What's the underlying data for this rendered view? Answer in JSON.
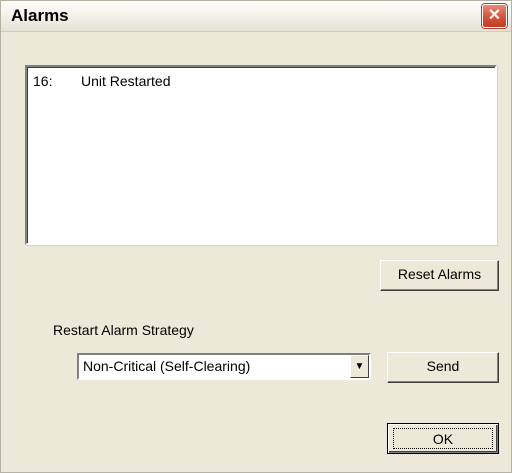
{
  "window": {
    "title": "Alarms",
    "close_icon": "close-icon"
  },
  "alarms": [
    {
      "number": "16:",
      "text": "Unit Restarted"
    }
  ],
  "buttons": {
    "reset": "Reset Alarms",
    "send": "Send",
    "ok": "OK"
  },
  "strategy": {
    "label": "Restart Alarm Strategy",
    "selected": "Non-Critical (Self-Clearing)"
  }
}
